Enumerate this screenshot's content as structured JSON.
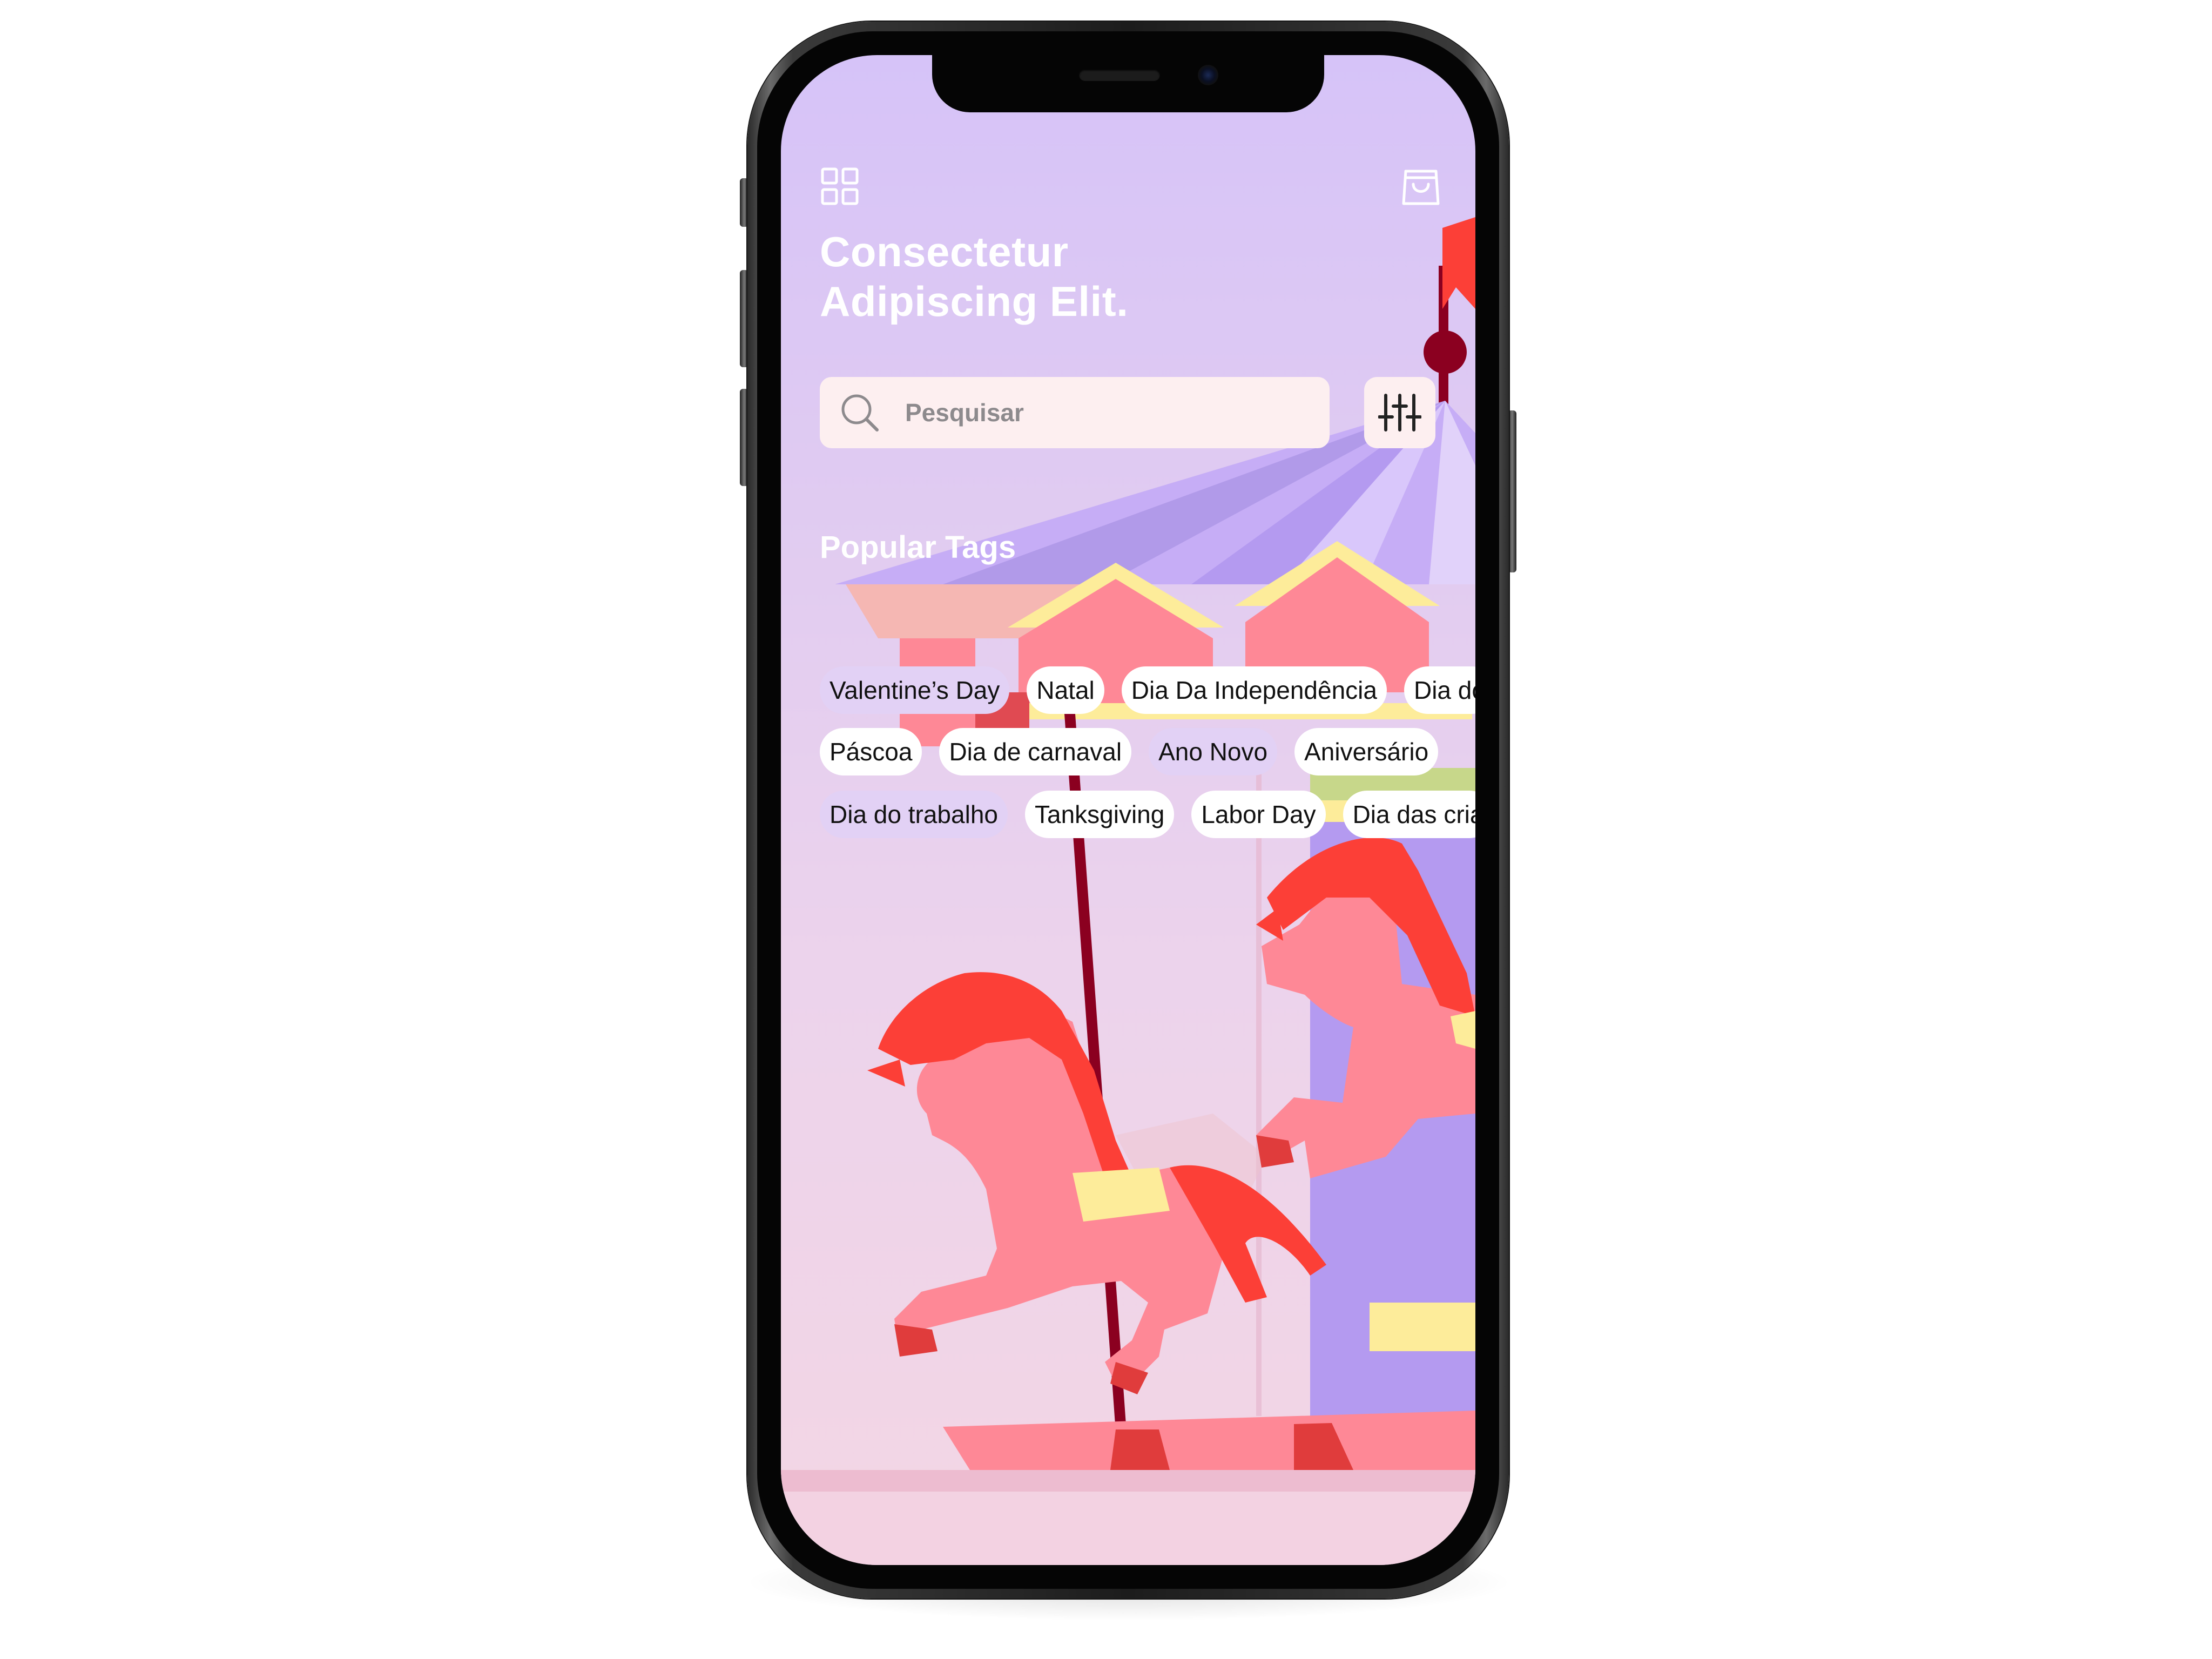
{
  "screen": {
    "header": {
      "menu_icon": "grid-icon",
      "cart_icon": "shopping-bag-icon"
    },
    "headline": {
      "line1": "Consectetur",
      "line2": "Adipiscing Elit."
    },
    "search": {
      "placeholder": "Pesquisar",
      "icon": "search-icon"
    },
    "filter": {
      "icon": "sliders-icon"
    },
    "popular_tags": {
      "title": "Popular Tags",
      "rows": [
        [
          "Valentine’s Day",
          "Natal",
          "Dia Da Independência",
          "Dia do"
        ],
        [
          "Páscoa",
          "Dia de carnaval",
          "Ano Novo",
          "Aniversário"
        ],
        [
          "Dia do trabalho",
          "Tanksgiving",
          "Labor Day",
          "Dia das cria"
        ]
      ]
    },
    "illustration": "carousel-horses-illustration"
  },
  "colors": {
    "background_top": "#d6c3f8",
    "background_bottom": "#f3d6e4",
    "tag_bg": "#ffffff",
    "tag_muted_bg": "#e2d1f5",
    "search_bg": "#fdeff0",
    "horse_body": "#fe8896",
    "horse_mane": "#fc3f37",
    "canopy_purple": "#b49af0",
    "pole": "#8b0020"
  }
}
